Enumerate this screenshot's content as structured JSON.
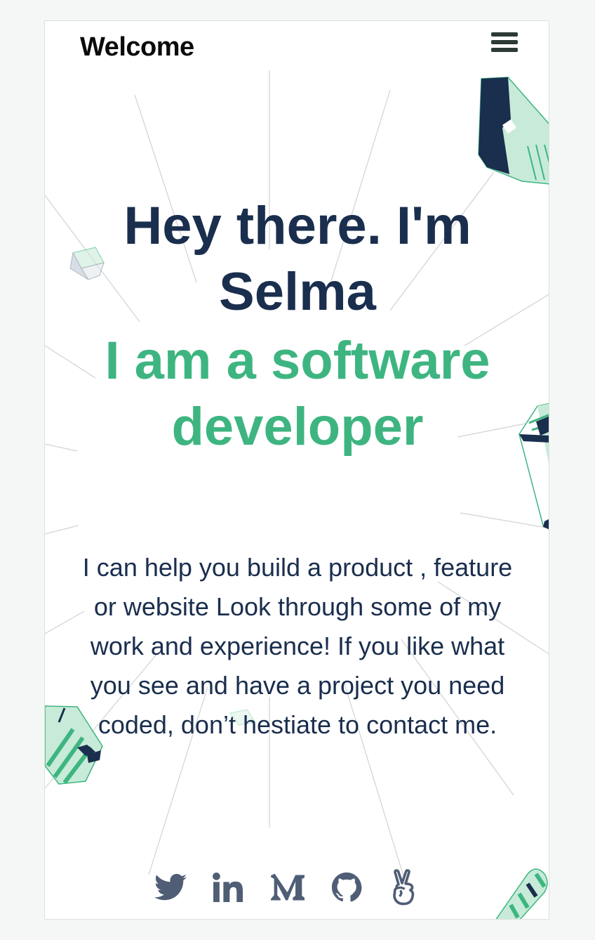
{
  "header": {
    "title": "Welcome",
    "menu_icon": "hamburger-icon"
  },
  "hero": {
    "greeting": "Hey there. I'm Selma",
    "role": "I am a software developer"
  },
  "intro": {
    "text": "I can help you build a product , feature or website Look through some of my work and experience! If you like what you see and have a project you need coded, don’t hestiate to contact me."
  },
  "socials": [
    {
      "icon": "twitter-icon"
    },
    {
      "icon": "linkedin-icon"
    },
    {
      "icon": "medium-icon"
    },
    {
      "icon": "github-icon"
    },
    {
      "icon": "angellist-icon"
    }
  ],
  "colors": {
    "navy": "#1a2e4e",
    "green": "#3eb581",
    "mint": "#c7ebd8",
    "icon_gray": "#4f5d75"
  }
}
